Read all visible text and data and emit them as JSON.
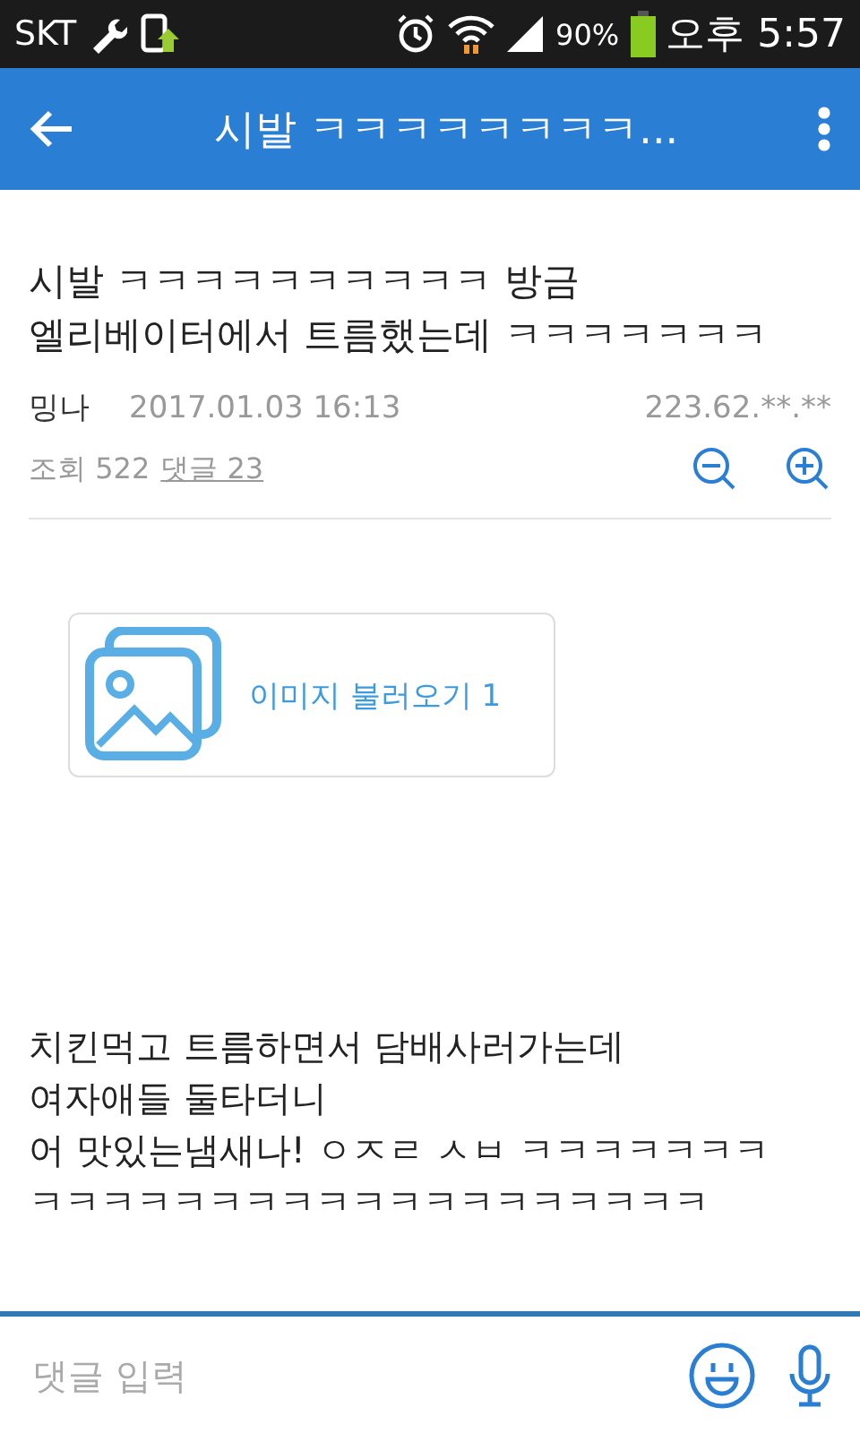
{
  "status_bar": {
    "carrier": "SKT",
    "battery": "90%",
    "time": "오후 5:57"
  },
  "app_bar": {
    "title": "시발 ㅋㅋㅋㅋㅋㅋㅋㅋ..."
  },
  "post": {
    "title": "시발 ㅋㅋㅋㅋㅋㅋㅋㅋㅋㅋ 방금\n엘리베이터에서 트름했는데 ㅋㅋㅋㅋㅋㅋㅋ",
    "author": "밍나",
    "date": "2017.01.03 16:13",
    "ip": "223.62.**.**",
    "views": "조회 522",
    "comments": "댓글 23",
    "image_button": "이미지 불러오기 1",
    "body": [
      "치킨먹고 트름하면서 담배사러가는데",
      "여자애들 둘타더니",
      "어 맛있는냄새나! ㅇㅈㄹ ㅅㅂ ㅋㅋㅋㅋㅋㅋㅋ",
      "ㅋㅋㅋㅋㅋㅋㅋㅋㅋㅋㅋㅋㅋㅋㅋㅋㅋㅋㅋ"
    ]
  },
  "comment_bar": {
    "placeholder": "댓글 입력"
  }
}
